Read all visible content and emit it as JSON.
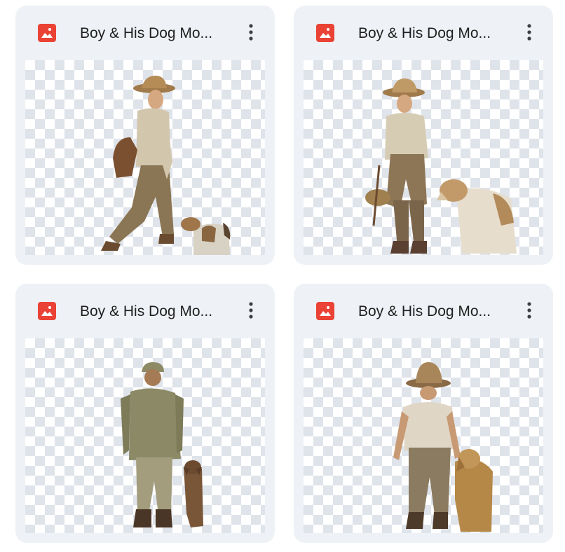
{
  "files": [
    {
      "title": "Boy & His Dog Mo...",
      "icon": "image-file-icon",
      "menu_icon": "more-vert-icon",
      "preview": "boy-walking-with-dog-side-view"
    },
    {
      "title": "Boy & His Dog Mo...",
      "icon": "image-file-icon",
      "menu_icon": "more-vert-icon",
      "preview": "boy-with-basket-and-dog"
    },
    {
      "title": "Boy & His Dog Mo...",
      "icon": "image-file-icon",
      "menu_icon": "more-vert-icon",
      "preview": "boy-and-dog-back-view"
    },
    {
      "title": "Boy & His Dog Mo...",
      "icon": "image-file-icon",
      "menu_icon": "more-vert-icon",
      "preview": "boy-in-hat-and-dog-back-view"
    }
  ],
  "colors": {
    "card_bg": "#eef1f6",
    "icon_red": "#ea4335",
    "title_text": "#1f1f1f",
    "checker": "#dfe3ea"
  }
}
